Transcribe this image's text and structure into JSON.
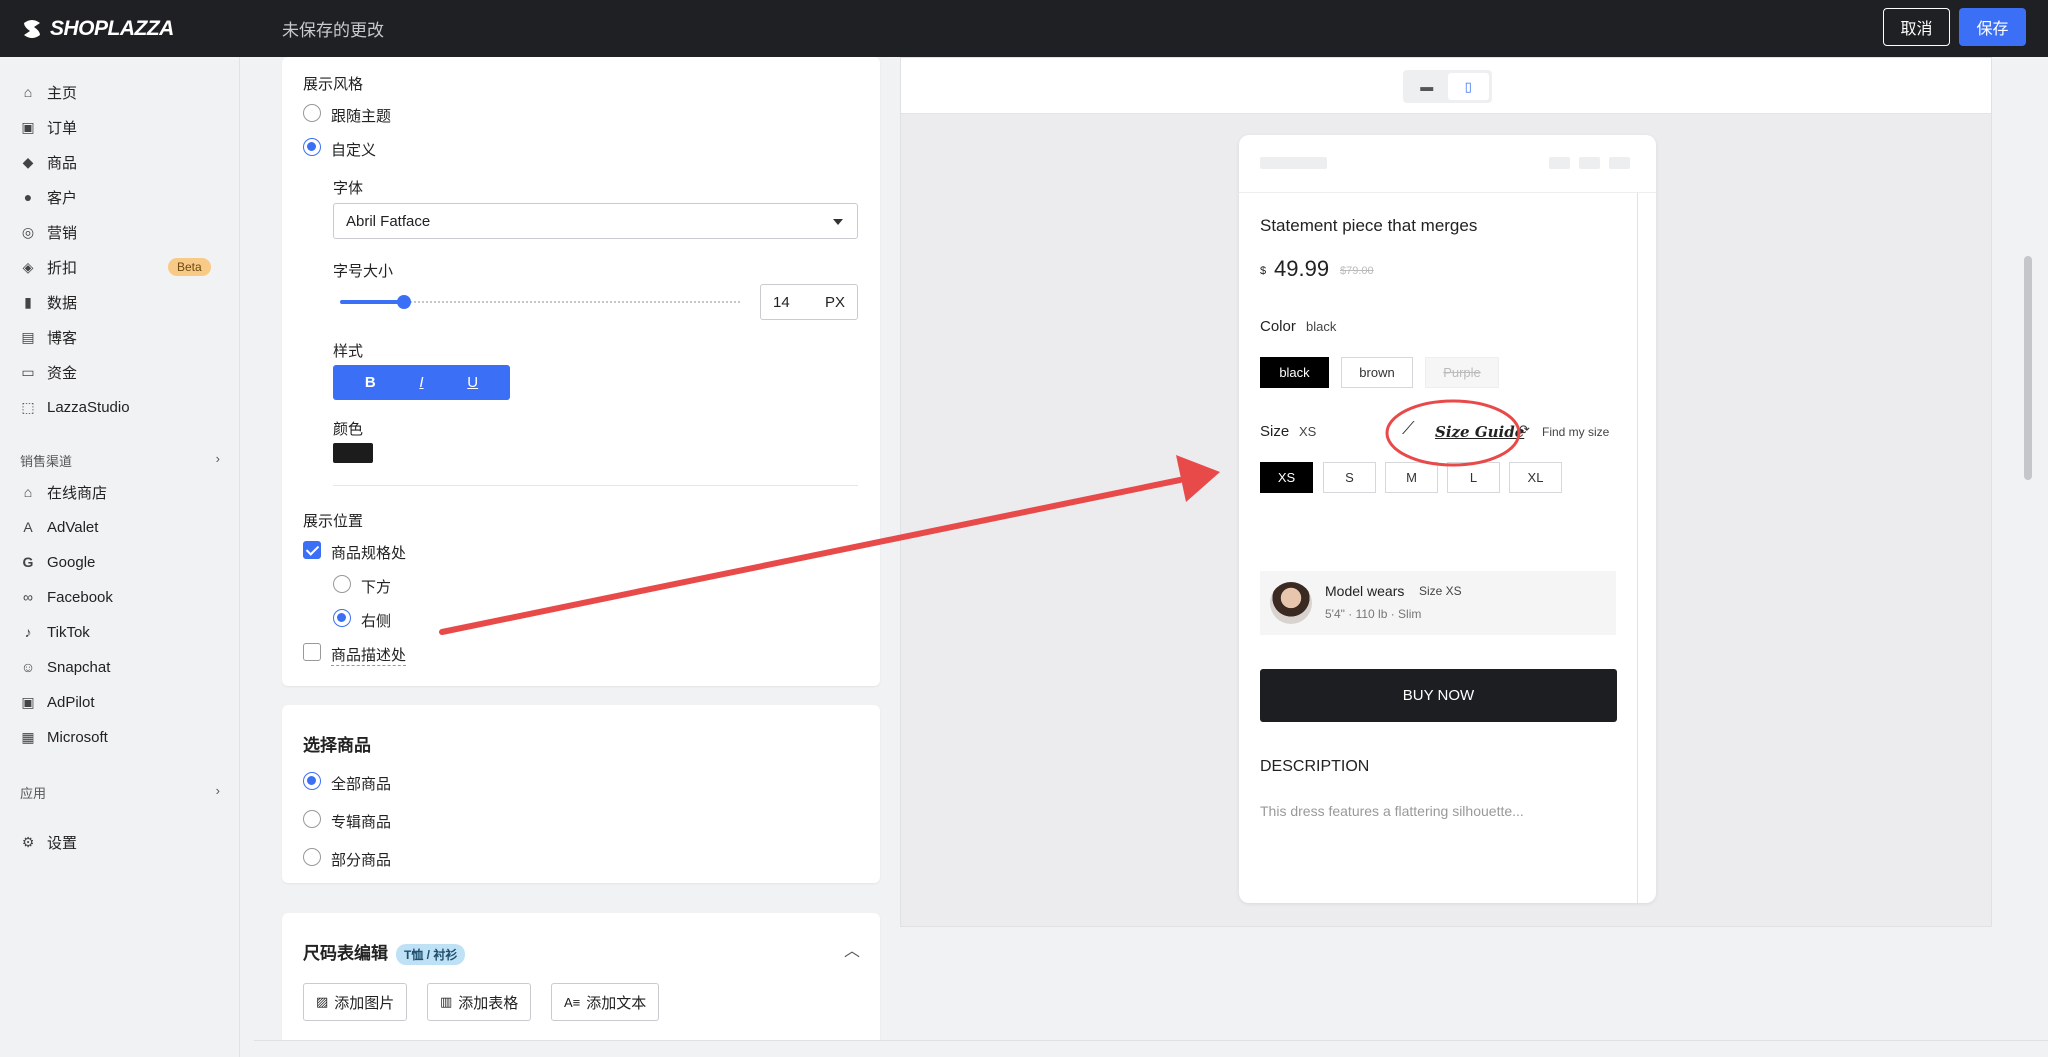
{
  "header": {
    "brand": "SHOPLAZZA",
    "status": "未保存的更改",
    "cancel_label": "取消",
    "save_label": "保存"
  },
  "sidebar": {
    "items": [
      {
        "label": "主页",
        "icon": "home-icon"
      },
      {
        "label": "订单",
        "icon": "inbox-icon"
      },
      {
        "label": "商品",
        "icon": "tag-icon"
      },
      {
        "label": "客户",
        "icon": "person-icon"
      },
      {
        "label": "营销",
        "icon": "target-icon"
      },
      {
        "label": "折扣",
        "icon": "discount-tag-icon",
        "badge": "Beta"
      },
      {
        "label": "数据",
        "icon": "bar-chart-icon"
      },
      {
        "label": "博客",
        "icon": "blog-icon"
      },
      {
        "label": "资金",
        "icon": "wallet-icon"
      },
      {
        "label": "LazzaStudio",
        "icon": "studio-icon"
      }
    ],
    "channels_title": "销售渠道",
    "channels": [
      {
        "label": "在线商店",
        "icon": "store-icon"
      },
      {
        "label": "AdValet",
        "icon": "advalet-icon"
      },
      {
        "label": "Google",
        "icon": "google-icon"
      },
      {
        "label": "Facebook",
        "icon": "meta-icon"
      },
      {
        "label": "TikTok",
        "icon": "tiktok-icon"
      },
      {
        "label": "Snapchat",
        "icon": "snapchat-icon"
      },
      {
        "label": "AdPilot",
        "icon": "adpilot-icon"
      },
      {
        "label": "Microsoft",
        "icon": "microsoft-icon"
      }
    ],
    "apps_title": "应用",
    "settings_label": "设置"
  },
  "style_card": {
    "title": "展示风格",
    "option_follow": "跟随主题",
    "option_custom": "自定义",
    "selected": "custom",
    "font_label": "字体",
    "font_value": "Abril Fatface",
    "size_label": "字号大小",
    "size_value": "14",
    "size_unit": "PX",
    "size_fraction": 0.16,
    "style_label": "样式",
    "style_buttons": [
      "B",
      "I",
      "U"
    ],
    "color_label": "颜色",
    "color_value": "#1c1c1c",
    "position_title": "展示位置",
    "position_spec": "商品规格处",
    "position_spec_checked": true,
    "position_below": "下方",
    "position_right": "右侧",
    "position_selected": "right",
    "position_desc": "商品描述处",
    "position_desc_checked": false
  },
  "products_card": {
    "title": "选择商品",
    "options": [
      "全部商品",
      "专辑商品",
      "部分商品"
    ],
    "selected": 0
  },
  "sizechart_card": {
    "title": "尺码表编辑",
    "badge": "T恤 / 衬衫",
    "buttons": [
      "添加图片",
      "添加表格",
      "添加文本"
    ]
  },
  "preview": {
    "product_title": "Statement piece that merges",
    "currency": "$",
    "price": "49.99",
    "compare_price": "$79.00",
    "color_label": "Color",
    "color_value": "black",
    "colors": [
      "black",
      "brown",
      "Purple"
    ],
    "size_label": "Size",
    "size_value": "XS",
    "size_guide": "Size Guide",
    "find_size": "Find my size",
    "sizes": [
      "XS",
      "S",
      "M",
      "L",
      "XL"
    ],
    "model_title": "Model wears",
    "model_size": "Size XS",
    "model_stats": "5'4\" · 110 lb · Slim",
    "buy_now": "BUY NOW",
    "desc_title": "DESCRIPTION",
    "desc_text": "This dress features a flattering silhouette..."
  },
  "colors": {
    "accent": "#3b6ff5",
    "topbar": "#1f2023",
    "annotation": "#e84a4a"
  }
}
